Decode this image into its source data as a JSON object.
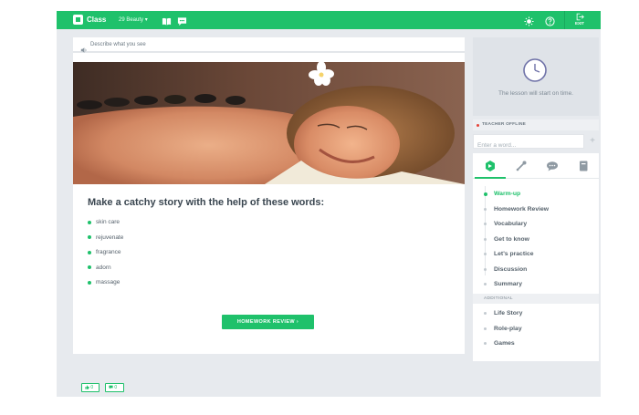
{
  "topbar": {
    "brand": "Class",
    "lesson_select": "29 Beauty",
    "exit_label": "EXIT",
    "icons": [
      "book-icon",
      "chat-icon",
      "brightness-icon",
      "help-icon",
      "exit-icon"
    ]
  },
  "lesson": {
    "instruction": "Describe what you see",
    "heading": "Make a catchy story with the help of these words:",
    "words": [
      "skin care",
      "rejuvenate",
      "fragrance",
      "adorn",
      "massage"
    ],
    "next_button": "HOMEWORK REVIEW ›"
  },
  "sidebar": {
    "start_message": "The lesson will start on time.",
    "teacher_status": "TEACHER OFFLINE",
    "word_placeholder": "Enter a word...",
    "add_label": "+",
    "tab_icons": [
      "lesson-plan-icon",
      "tools-icon",
      "chat-icon",
      "notebook-icon"
    ],
    "plan": [
      "Warm-up",
      "Homework Review",
      "Vocabulary",
      "Get to know",
      "Let's practice",
      "Discussion",
      "Summary"
    ],
    "active_step": "Warm-up",
    "additional_label": "ADDITIONAL",
    "additional": [
      "Life Story",
      "Role-play",
      "Games"
    ]
  },
  "reactions": {
    "likes": "0",
    "comments": "0"
  },
  "colors": {
    "accent": "#1fc16b",
    "offline": "#e5443a",
    "background": "#e7eaee"
  }
}
